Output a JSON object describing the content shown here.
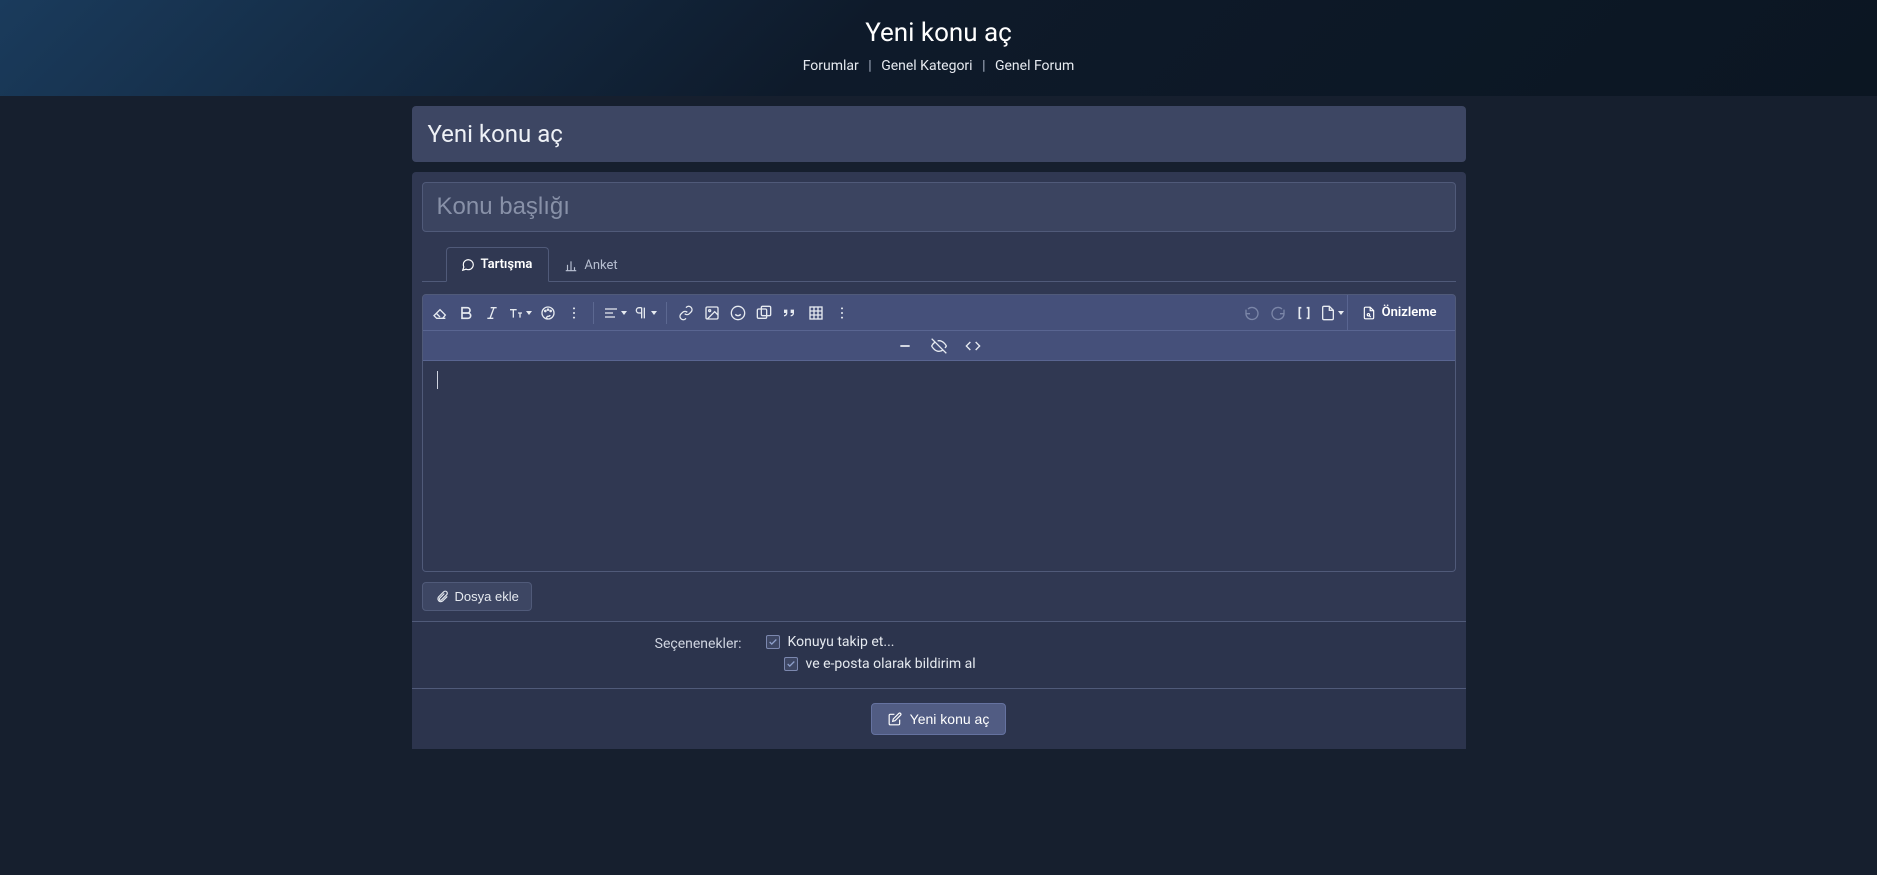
{
  "hero": {
    "title": "Yeni konu aç",
    "breadcrumb": [
      "Forumlar",
      "Genel Kategori",
      "Genel Forum"
    ]
  },
  "panel": {
    "heading": "Yeni konu aç"
  },
  "form": {
    "title_placeholder": "Konu başlığı",
    "tabs": [
      {
        "id": "discussion",
        "label": "Tartışma",
        "active": true
      },
      {
        "id": "poll",
        "label": "Anket",
        "active": false
      }
    ],
    "toolbar": {
      "eraser": "eraser-icon",
      "bold": "bold-icon",
      "italic": "italic-icon",
      "textsize": "textsize-icon",
      "color": "palette-icon",
      "more1": "more-icon",
      "align": "align-icon",
      "paragraph": "paragraph-icon",
      "link": "link-icon",
      "image": "image-icon",
      "smile": "smile-icon",
      "gallery": "gallery-icon",
      "quote": "quote-icon",
      "table": "table-icon",
      "more2": "more-icon",
      "undo": "undo-icon",
      "redo": "redo-icon",
      "brackets": "brackets-icon",
      "page": "page-icon",
      "preview_label": "Önizleme",
      "sub_minus": "minus-icon",
      "sub_eyeoff": "eyeoff-icon",
      "sub_code": "code-icon"
    },
    "attach_label": "Dosya ekle",
    "options": {
      "label": "Seçenenekler:",
      "follow": "Konuyu takip et...",
      "email": "ve e-posta olarak bildirim al"
    },
    "submit_label": "Yeni konu aç"
  }
}
